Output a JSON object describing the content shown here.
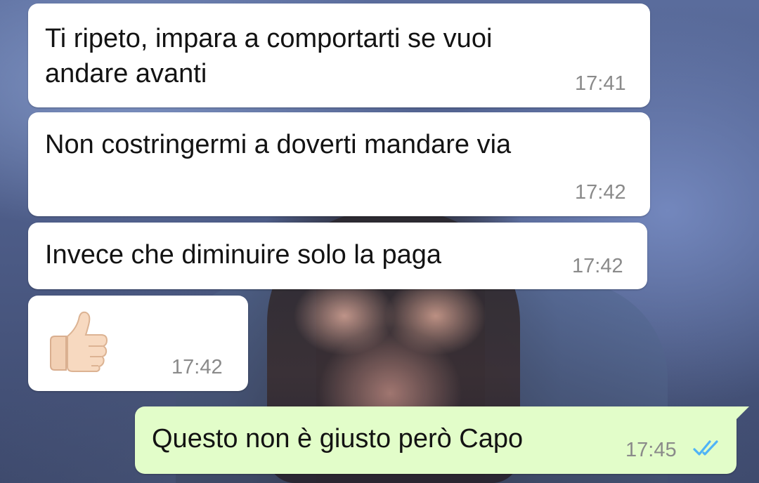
{
  "chat": {
    "messages": [
      {
        "direction": "incoming",
        "text_line1": "Ti ripeto, impara a comportarti se vuoi",
        "text_line2": "andare avanti",
        "time": "17:41"
      },
      {
        "direction": "incoming",
        "text": "Non costringermi a doverti mandare via",
        "time": "17:42"
      },
      {
        "direction": "incoming",
        "text": "Invece che diminuire solo la paga",
        "time": "17:42"
      },
      {
        "direction": "incoming",
        "emoji": "thumbs-up",
        "time": "17:42"
      },
      {
        "direction": "outgoing",
        "text": "Questo non è giusto però Capo",
        "time": "17:45",
        "status": "read"
      }
    ]
  },
  "colors": {
    "incoming_bubble": "#ffffff",
    "outgoing_bubble": "#e2fdc9",
    "read_ticks": "#4fb3f7",
    "timestamp": "#8a8a8a"
  },
  "icons": {
    "read_receipt": "double-check-icon",
    "emoji": "thumbs-up-icon"
  }
}
